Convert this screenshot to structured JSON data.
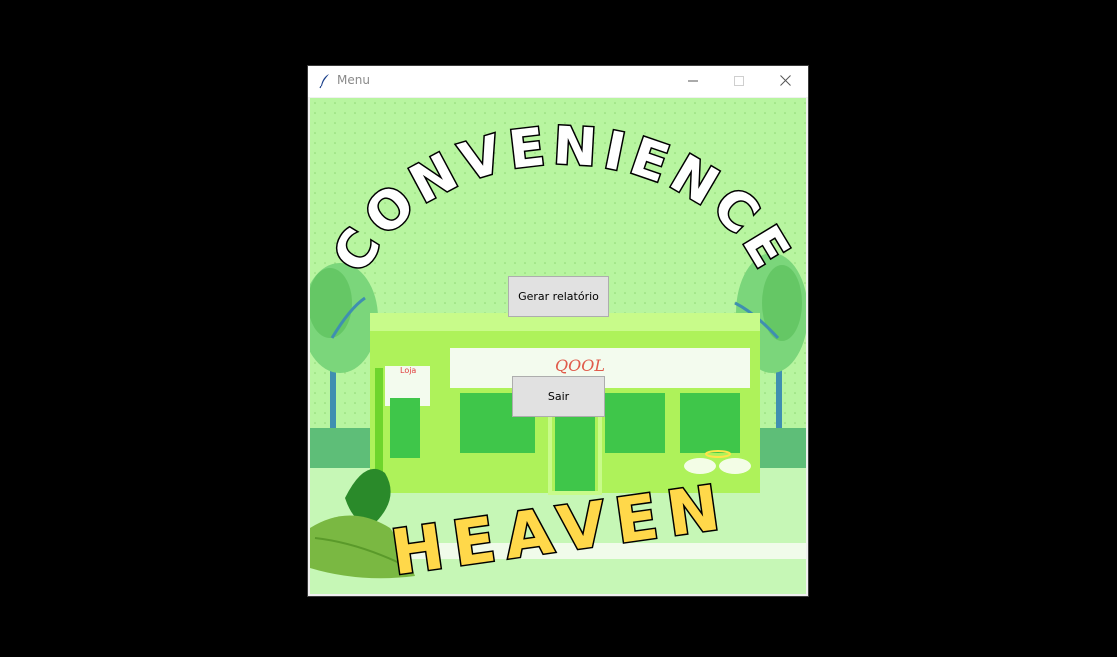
{
  "window": {
    "title": "Menu",
    "controls": {
      "minimize_icon": "minimize-icon",
      "maximize_icon": "maximize-icon",
      "close_icon": "close-icon"
    }
  },
  "brand": {
    "top_word": "CONVENIENCE",
    "bottom_word": "HEAVEN",
    "shop_sign": "Loja",
    "shop_logo": "QOOL"
  },
  "buttons": {
    "report_label": "Gerar relatório",
    "exit_label": "Sair"
  },
  "colors": {
    "background_green": "#b8f5a0",
    "building_green": "#aef25a",
    "heaven_yellow": "#ffd84a",
    "leaf_dark": "#2a8a2a"
  }
}
